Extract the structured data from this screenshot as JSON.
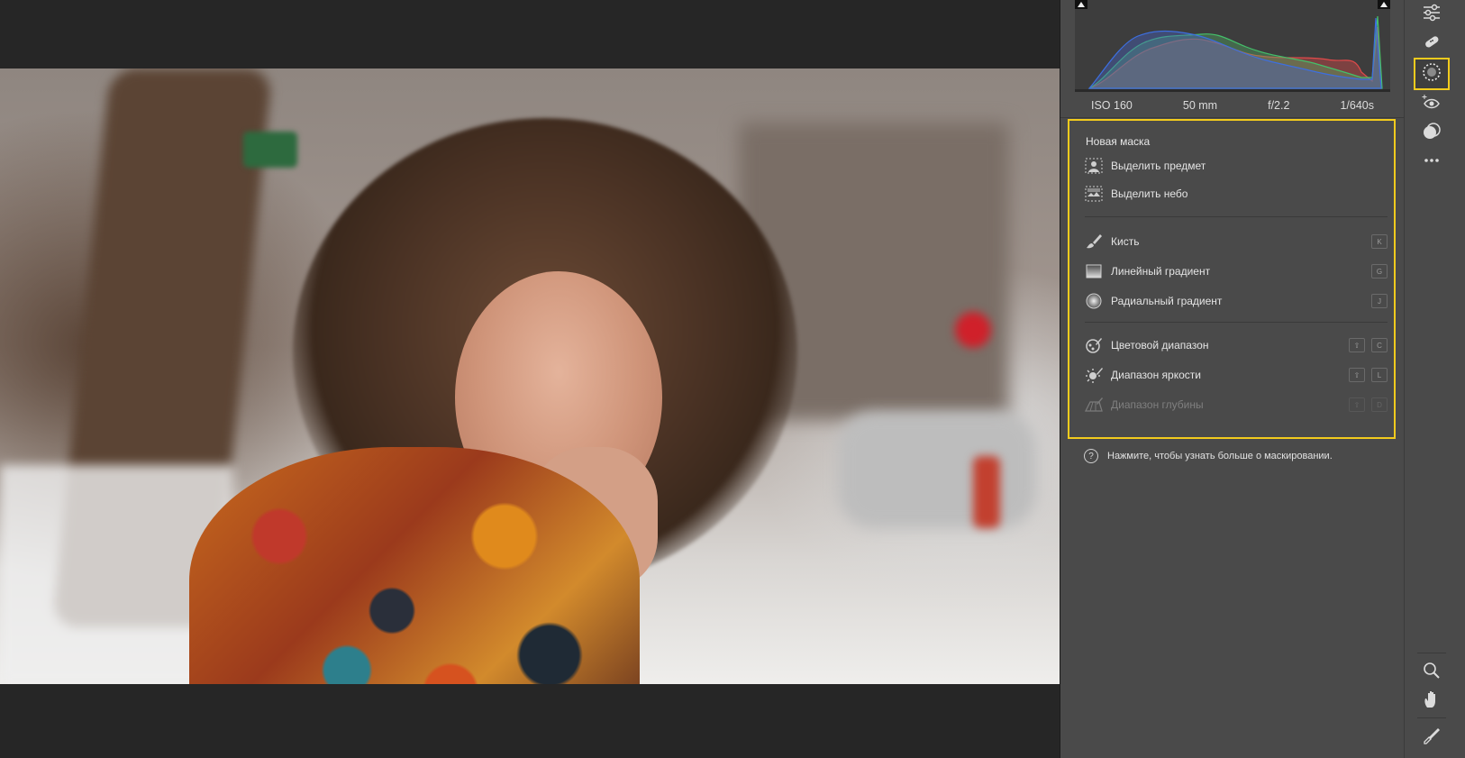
{
  "histogram": {
    "exif": {
      "iso": "ISO 160",
      "focal": "50 mm",
      "aperture": "f/2.2",
      "shutter": "1/640s"
    }
  },
  "masking": {
    "title": "Новая маска",
    "items": [
      {
        "label": "Выделить предмет",
        "icon": "select-subject-icon",
        "keys": []
      },
      {
        "label": "Выделить небо",
        "icon": "select-sky-icon",
        "keys": []
      },
      {
        "label": "Кисть",
        "icon": "brush-icon",
        "keys": [
          "K"
        ]
      },
      {
        "label": "Линейный градиент",
        "icon": "linear-gradient-icon",
        "keys": [
          "G"
        ]
      },
      {
        "label": "Радиальный градиент",
        "icon": "radial-gradient-icon",
        "keys": [
          "J"
        ]
      },
      {
        "label": "Цветовой диапазон",
        "icon": "color-range-icon",
        "keys": [
          "⇧",
          "C"
        ]
      },
      {
        "label": "Диапазон яркости",
        "icon": "luminance-range-icon",
        "keys": [
          "⇧",
          "L"
        ]
      },
      {
        "label": "Диапазон глубины",
        "icon": "depth-range-icon",
        "keys": [
          "⇧",
          "D"
        ],
        "disabled": true
      }
    ]
  },
  "help": {
    "text": "Нажмите, чтобы узнать больше о маскировании."
  },
  "toolbar": {
    "top_tools": [
      "edit-sliders-icon",
      "healing-icon",
      "masking-icon",
      "red-eye-icon",
      "presets-icon",
      "more-icon"
    ],
    "bottom_tools": [
      "zoom-icon",
      "hand-icon",
      "color-sampler-icon"
    ],
    "active_tool": "masking-icon"
  },
  "colors": {
    "accent_highlight": "#f2cb1d",
    "panel_bg": "#4a4a4a",
    "canvas_bg": "#262626"
  }
}
